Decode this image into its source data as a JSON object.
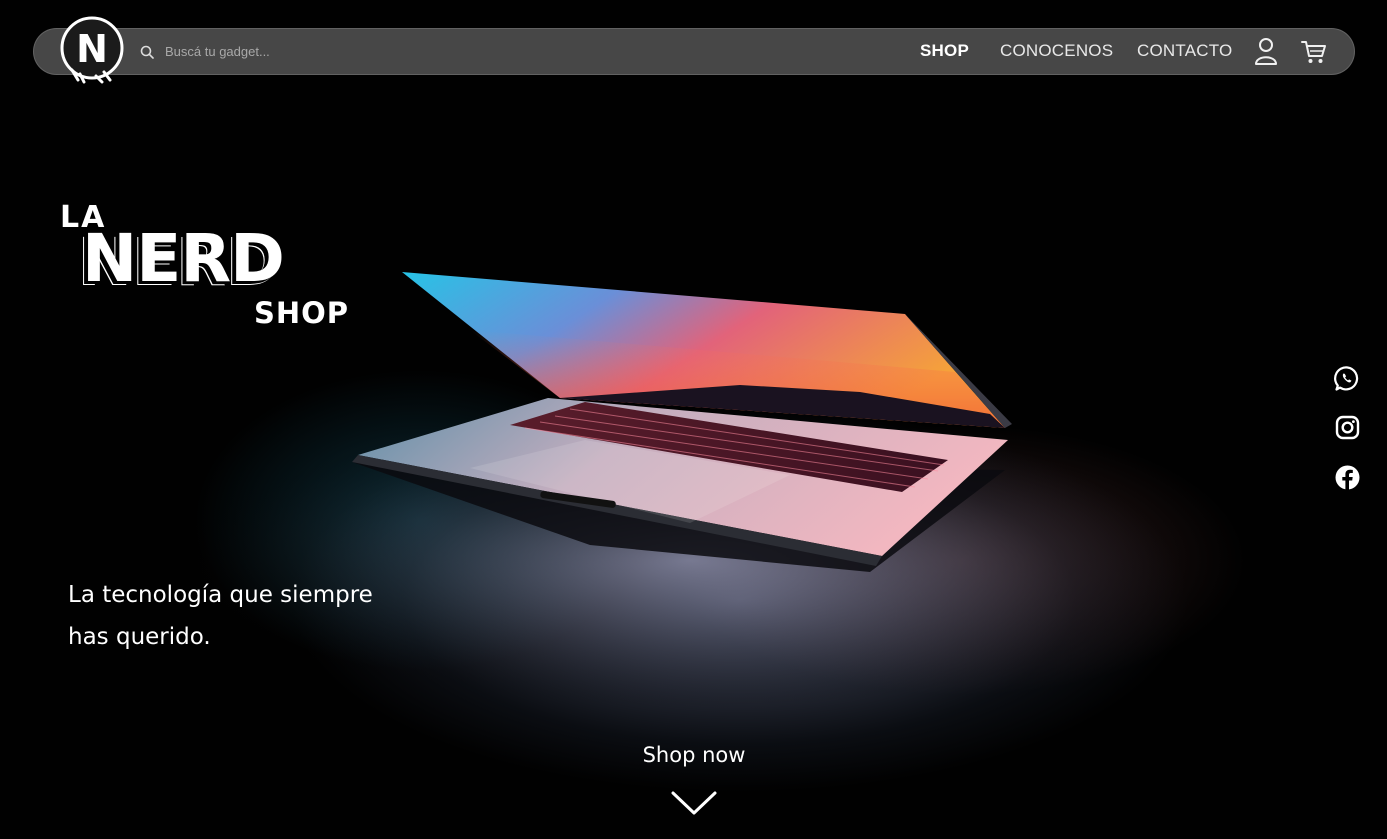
{
  "header": {
    "logo_letter": "N",
    "search": {
      "placeholder": "Buscá tu gadget...",
      "value": ""
    },
    "nav": [
      {
        "label": "SHOP",
        "active": true
      },
      {
        "label": "CONOCENOS",
        "active": false
      },
      {
        "label": "CONTACTO",
        "active": false
      }
    ],
    "icons": [
      "user-icon",
      "cart-icon"
    ]
  },
  "brand": {
    "line1": "LA",
    "line2": "NERD",
    "line3": "SHOP"
  },
  "hero": {
    "tagline_line1": "La tecnología que siempre",
    "tagline_line2": "has querido.",
    "cta_label": "Shop now",
    "cta_icon": "chevron-down-icon"
  },
  "social": [
    "whatsapp-icon",
    "instagram-icon",
    "facebook-icon"
  ],
  "colors": {
    "background": "#010101",
    "navbar": "#737373",
    "text": "#ffffff"
  }
}
